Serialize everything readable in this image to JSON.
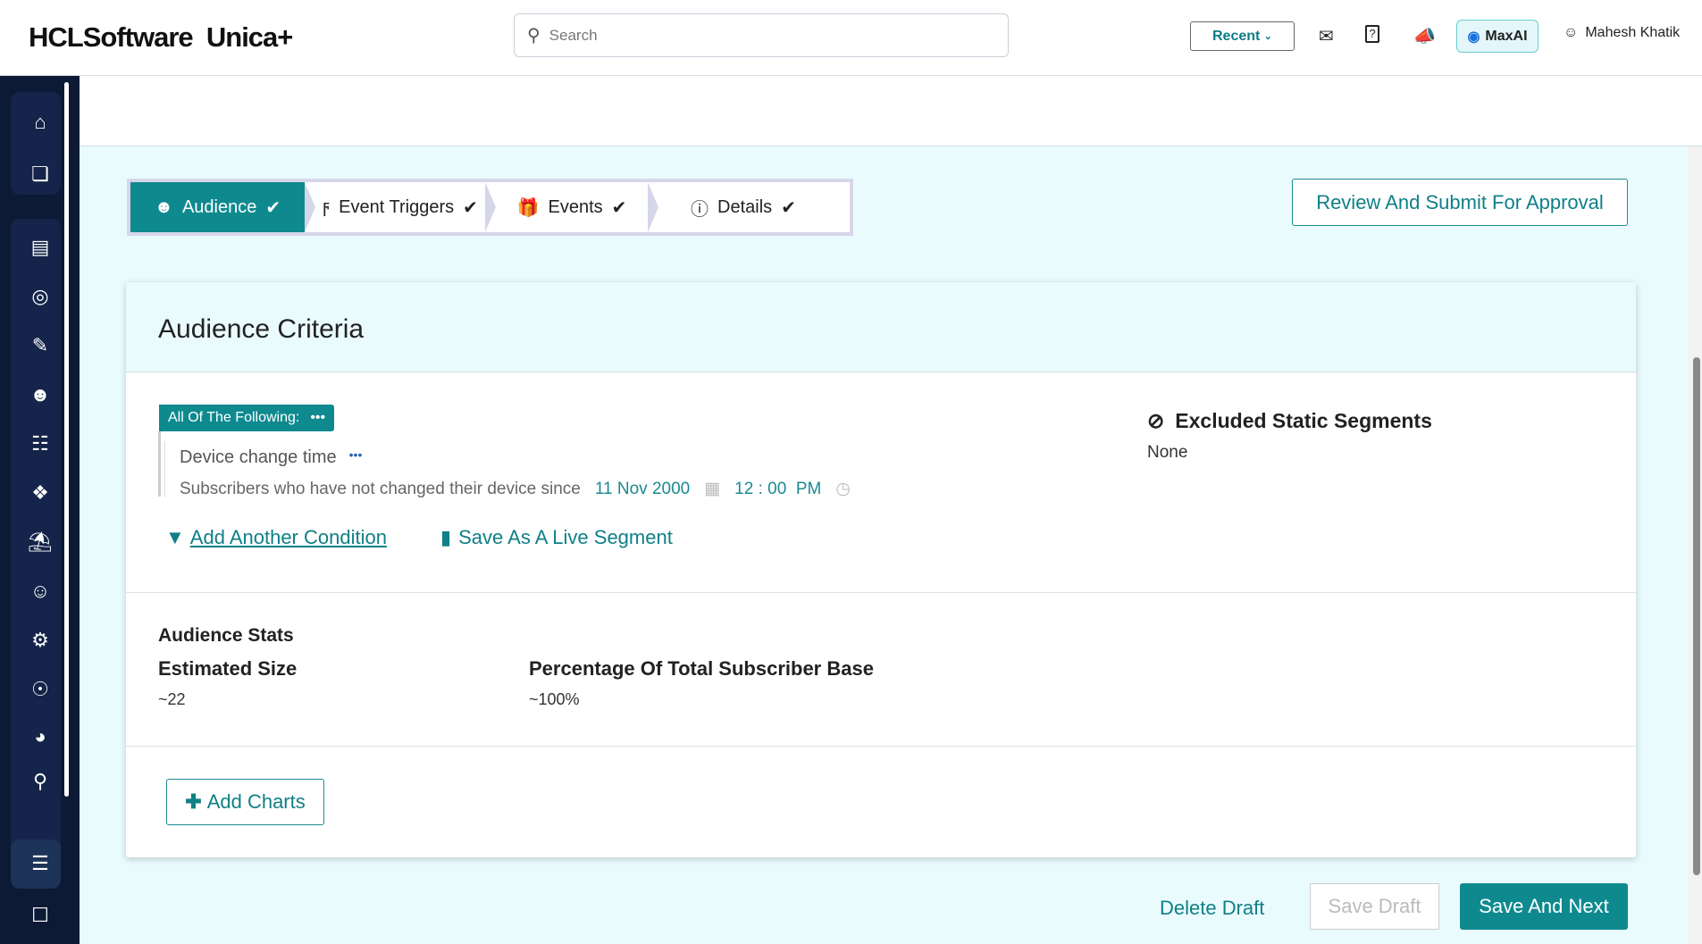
{
  "header": {
    "brand": "HCLSoftware",
    "product": "Unica+",
    "search_placeholder": "Search",
    "recent": "Recent",
    "maxai": "MaxAI",
    "user": "Mahesh Khatik"
  },
  "steps": [
    {
      "label": "Audience"
    },
    {
      "label": "Event Triggers"
    },
    {
      "label": "Events"
    },
    {
      "label": "Details"
    }
  ],
  "review_button": "Review And Submit For Approval",
  "card": {
    "title": "Audience Criteria",
    "group_label": "All Of The Following:",
    "condition": {
      "name": "Device change time",
      "description": "Subscribers who have not changed their device since",
      "date": "11 Nov 2000",
      "time": "12 : 00  PM"
    },
    "add_condition": "Add Another Condition",
    "save_live": "Save As A Live Segment",
    "excluded_title": "Excluded Static Segments",
    "excluded_value": "None",
    "stats_title": "Audience Stats",
    "estimated_label": "Estimated Size",
    "estimated_value": "~22",
    "percent_label": "Percentage Of Total Subscriber Base",
    "percent_value": "~100%",
    "add_charts": "Add Charts"
  },
  "footer": {
    "delete": "Delete Draft",
    "save_draft": "Save Draft",
    "save_next": "Save And Next"
  }
}
